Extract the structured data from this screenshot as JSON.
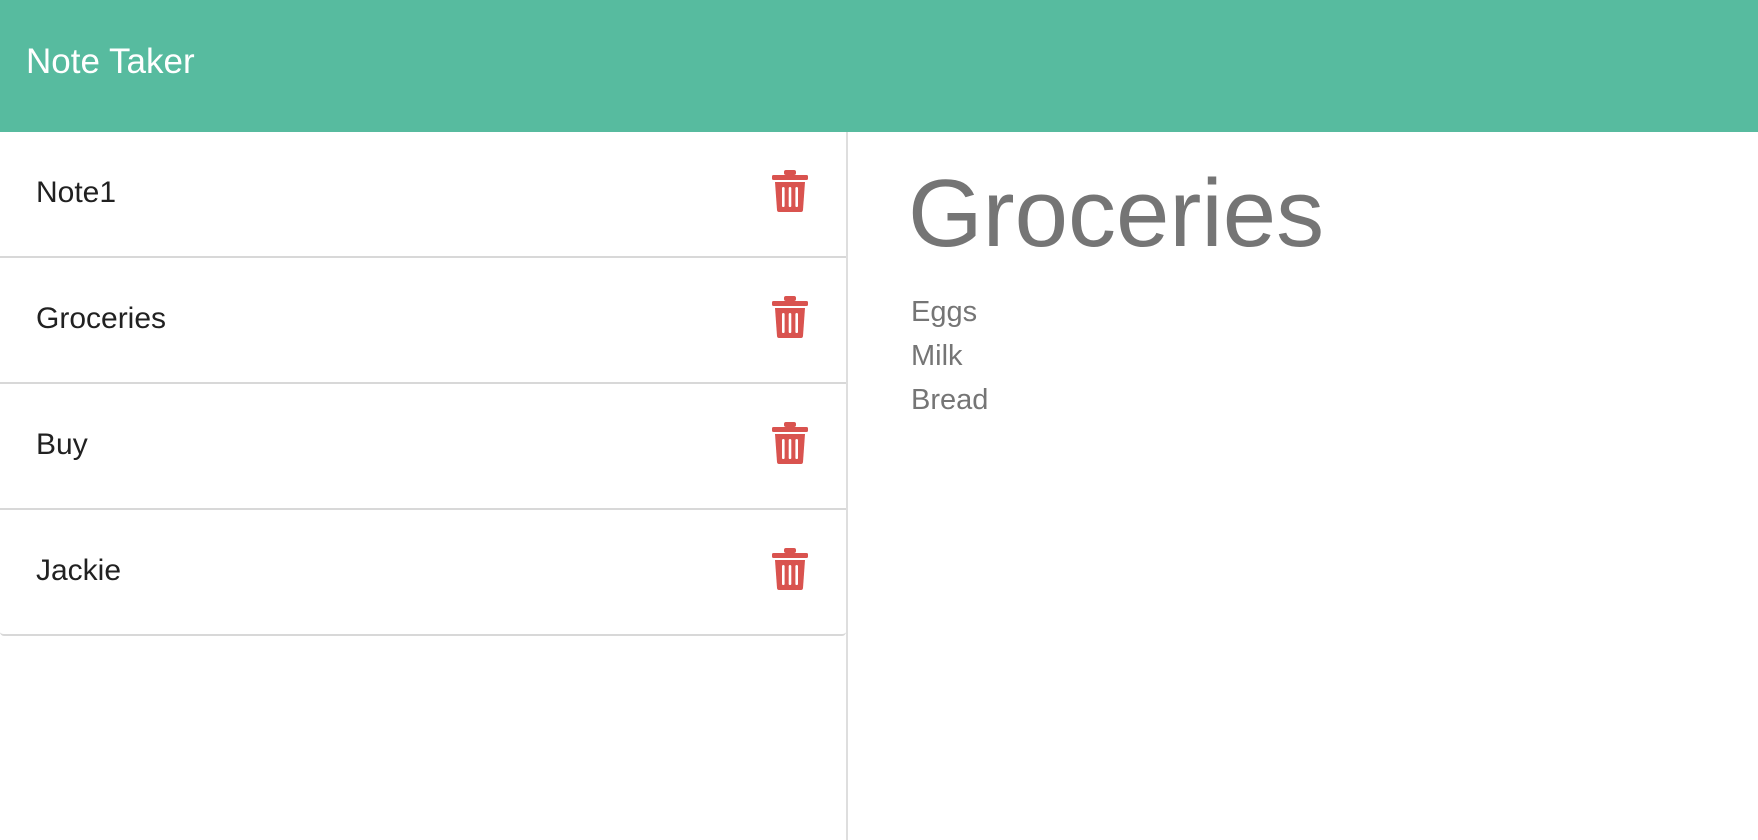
{
  "app": {
    "title": "Note Taker"
  },
  "colors": {
    "navbar": "#57bb9f",
    "delete_icon": "#d9534f",
    "note_text": "#212121",
    "view_text": "#757575"
  },
  "notes": [
    {
      "title": "Note1",
      "icon": "trash-icon"
    },
    {
      "title": "Groceries",
      "icon": "trash-icon"
    },
    {
      "title": "Buy",
      "icon": "trash-icon"
    },
    {
      "title": "Jackie",
      "icon": "trash-icon"
    }
  ],
  "active_note": {
    "title": "Groceries",
    "lines": [
      "Eggs",
      "Milk",
      "Bread"
    ]
  }
}
